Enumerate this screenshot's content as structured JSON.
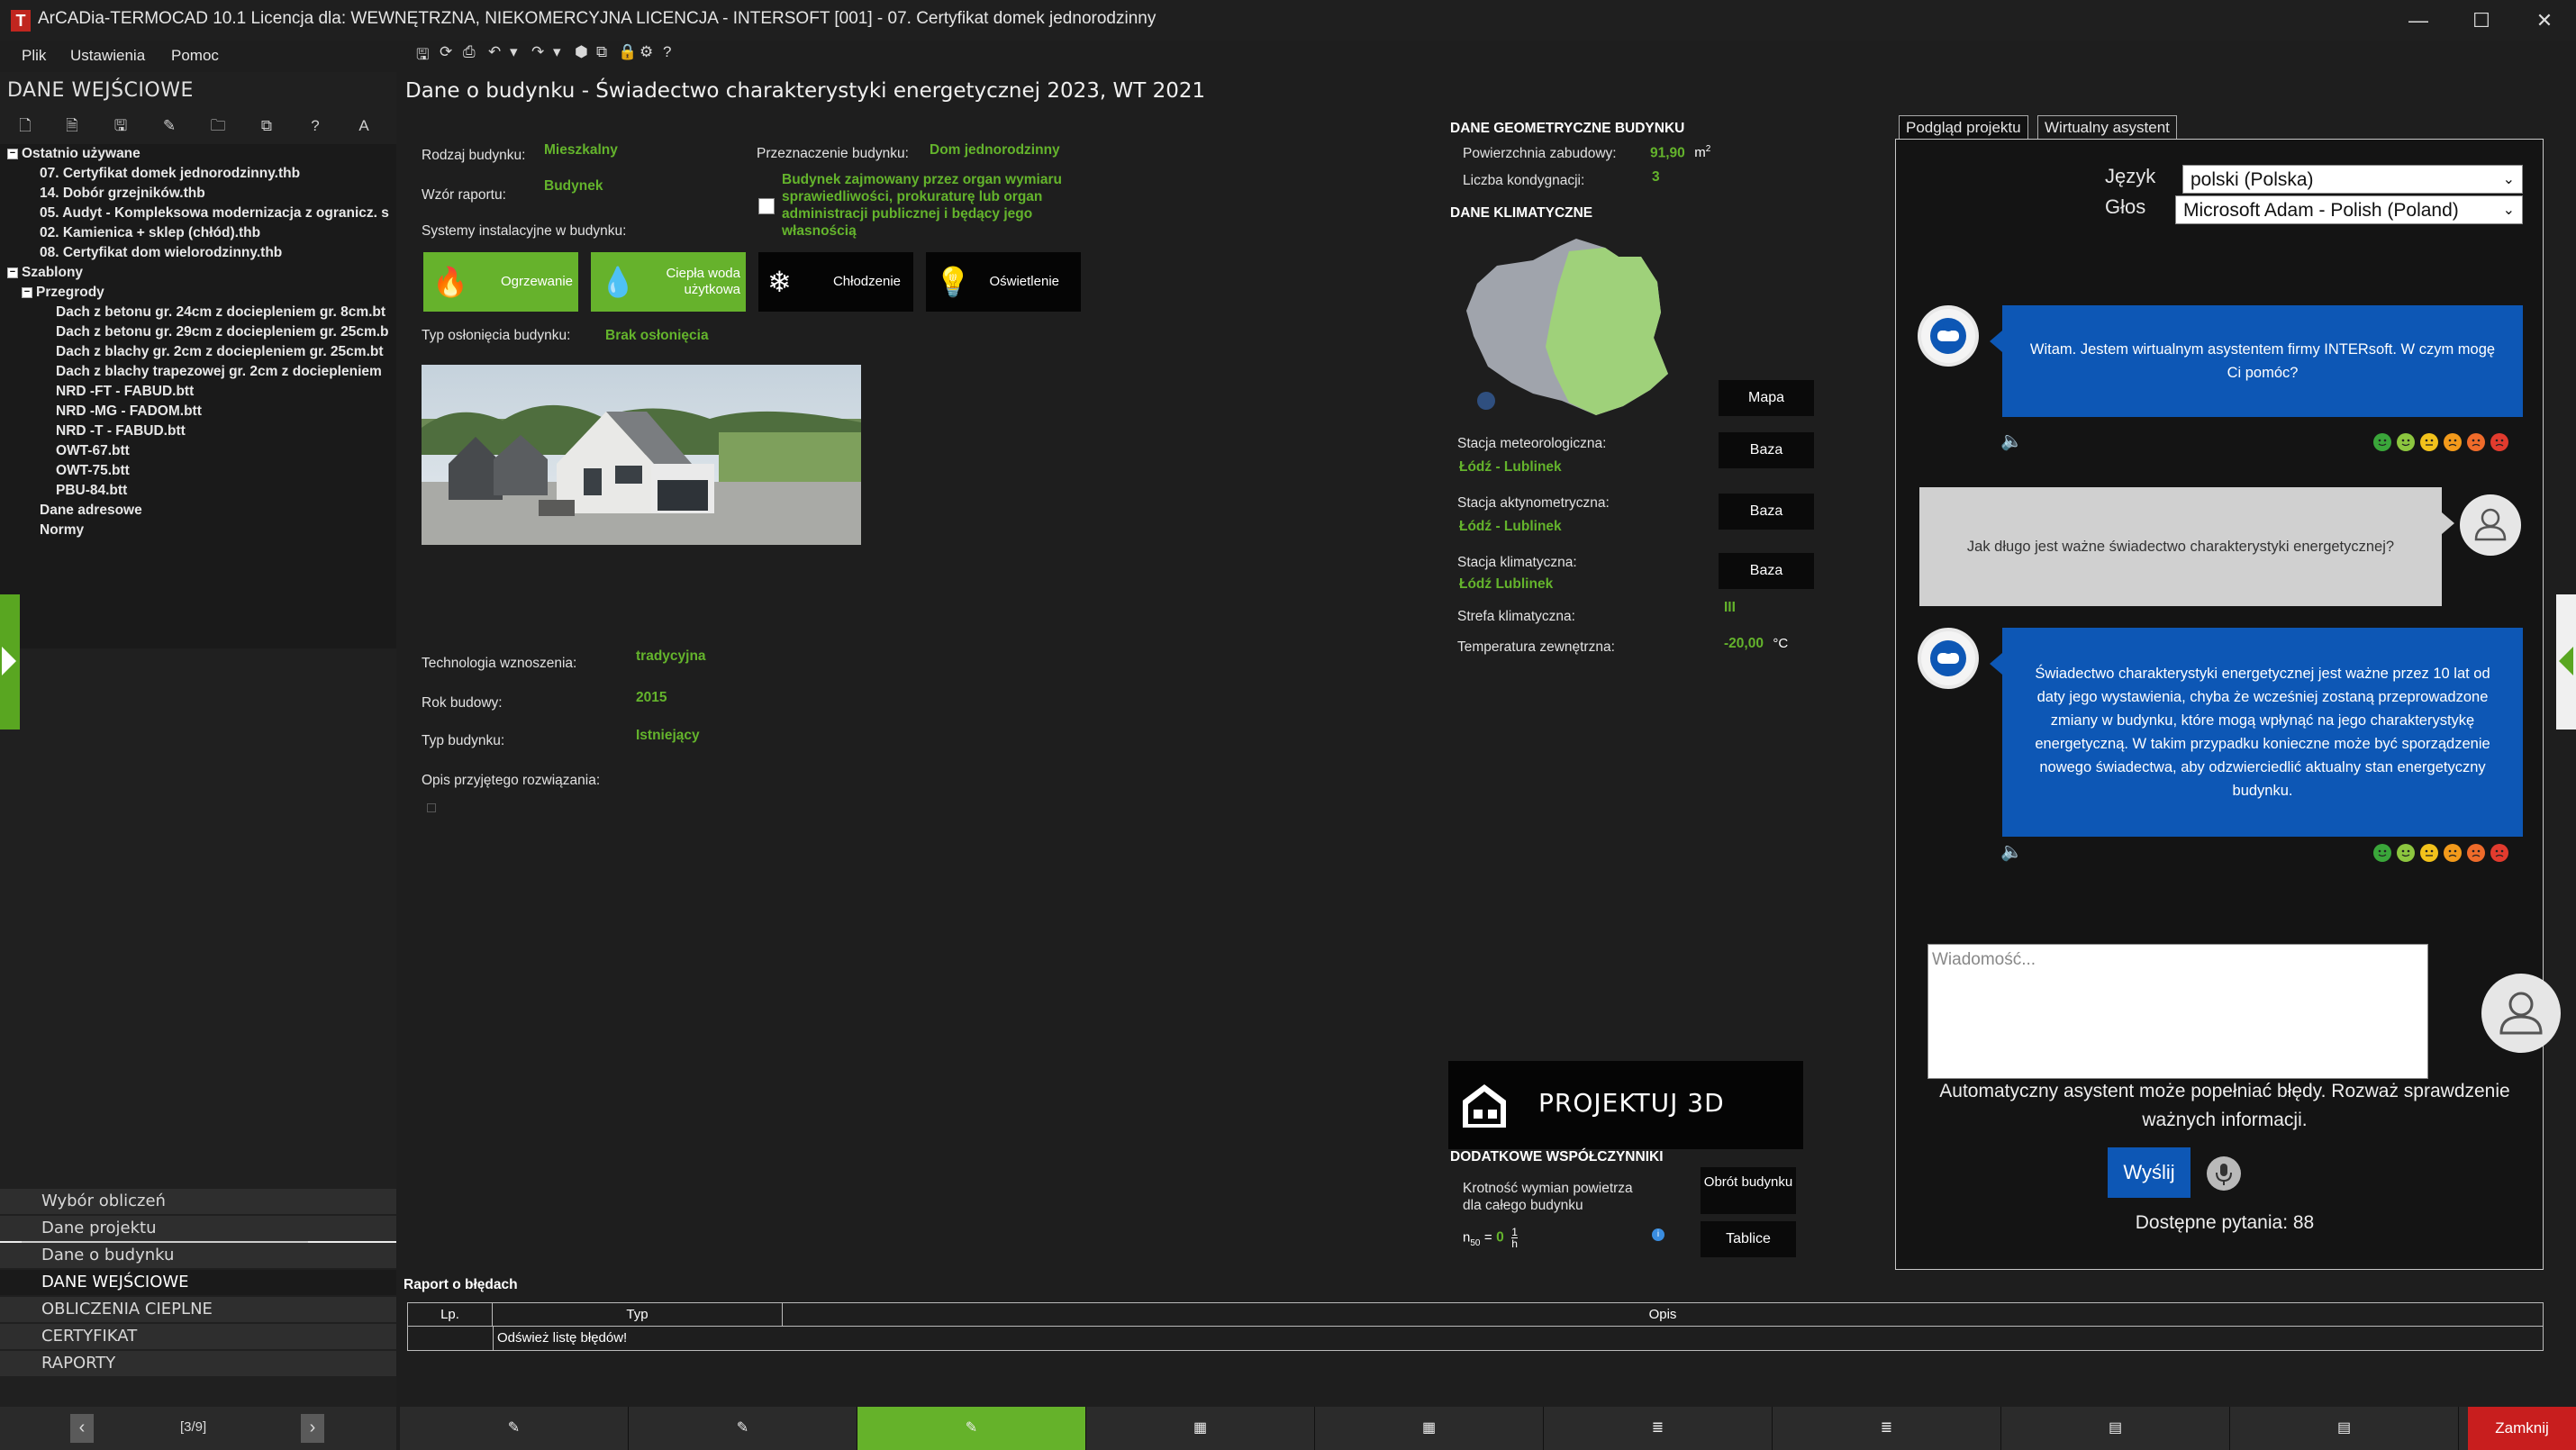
{
  "window": {
    "title": "ArCADia-TERMOCAD 10.1 Licencja dla: WEWNĘTRZNA, NIEKOMERCYJNA LICENCJA - INTERSOFT [001] - 07. Certyfikat domek jednorodzinny",
    "controls": {
      "minimize": "—",
      "maximize": "☐",
      "close": "✕"
    }
  },
  "menu": [
    "Plik",
    "Ustawienia",
    "Pomoc"
  ],
  "left": {
    "title": "DANE WEJŚCIOWE",
    "tree": {
      "recent_header": "Ostatnio używane",
      "recent": [
        "07. Certyfikat domek jednorodzinny.thb",
        "14. Dobór grzejników.thb",
        "05. Audyt - Kompleksowa modernizacja z ogranicz. s",
        "02. Kamienica + sklep (chłód).thb",
        "08. Certyfikat dom wielorodzinny.thb"
      ],
      "templates_header": "Szablony",
      "partitions_header": "Przegrody",
      "partitions": [
        "Dach z betonu gr. 24cm z dociepleniem gr. 8cm.bt",
        "Dach z betonu gr. 29cm z dociepleniem gr. 25cm.b",
        "Dach z blachy gr. 2cm z dociepleniem gr. 25cm.bt",
        "Dach z blachy trapezowej gr. 2cm z dociepleniem",
        "NRD -FT - FABUD.btt",
        "NRD -MG - FADOM.btt",
        "NRD -T - FABUD.btt",
        "OWT-67.btt",
        "OWT-75.btt",
        "PBU-84.btt"
      ],
      "address": "Dane adresowe",
      "norms": "Normy",
      "expand_sign": "−"
    },
    "scroll": {
      "left": "‹",
      "right": "›"
    },
    "nav": [
      "Wybór obliczeń",
      "Dane projektu",
      "Dane o budynku",
      "DANE WEJŚCIOWE",
      "OBLICZENIA CIEPLNE",
      "CERTYFIKAT",
      "RAPORTY"
    ],
    "pager": {
      "prev": "‹",
      "text": "[3/9]",
      "next": "›"
    }
  },
  "main": {
    "title": "Dane o budynku - Świadectwo charakterystyki energetycznej 2023, WT 2021",
    "building_type_label": "Rodzaj budynku:",
    "building_type": "Mieszkalny",
    "report_template_label": "Wzór raportu:",
    "report_template": "Budynek",
    "purpose_label": "Przeznaczenie budynku:",
    "purpose": "Dom jednorodzinny",
    "public_building": "Budynek zajmowany przez organ wymiaru sprawiedliwości, prokuraturę lub organ administracji publicznej i będący jego własnością",
    "systems_label": "Systemy instalacyjne w budynku:",
    "systems": [
      {
        "label": "Ogrzewanie",
        "icon": "flame-icon",
        "glyph": "🔥",
        "active": true
      },
      {
        "label": "Ciepła woda użytkowa",
        "icon": "water-drop-icon",
        "glyph": "💧",
        "active": true
      },
      {
        "label": "Chłodzenie",
        "icon": "snowflake-icon",
        "glyph": "❄",
        "active": false
      },
      {
        "label": "Oświetlenie",
        "icon": "lightbulb-icon",
        "glyph": "💡",
        "active": false
      }
    ],
    "shading_label": "Typ osłonięcia budynku:",
    "shading": "Brak osłonięcia",
    "technology_label": "Technologia wznoszenia:",
    "technology": "tradycyjna",
    "year_label": "Rok budowy:",
    "year": "2015",
    "btype_label": "Typ budynku:",
    "btype": "Istniejący",
    "description_label": "Opis przyjętego rozwiązania:"
  },
  "geometry": {
    "header": "DANE GEOMETRYCZNE BUDYNKU",
    "area_label": "Powierzchnia zabudowy:",
    "area": "91,90",
    "area_unit": "m",
    "area_sup": "2",
    "floors_label": "Liczba kondygnacji:",
    "floors": "3"
  },
  "climate": {
    "header": "DANE KLIMATYCZNE",
    "map_button": "Mapa",
    "meteo_label": "Stacja meteorologiczna:",
    "meteo": "Łódź - Lublinek",
    "meteo_button": "Baza",
    "actino_label": "Stacja aktynometryczna:",
    "actino": "Łódź - Lublinek",
    "actino_button": "Baza",
    "climate_label": "Stacja klimatyczna:",
    "climate": "Łódź Lublinek",
    "climate_button": "Baza",
    "zone_label": "Strefa klimatyczna:",
    "zone": "III",
    "temp_label": "Temperatura zewnętrzna:",
    "temp": "-20,00",
    "temp_unit": "°C"
  },
  "project3d": {
    "label": "PROJEKTUJ 3D"
  },
  "coefficients": {
    "header": "DODATKOWE WSPÓŁCZYNNIKI",
    "exchange_label": "Krotność wymian powietrza dla całego budynku",
    "n50_label": "n",
    "n50_sub": "50",
    "n50_eq": "=",
    "n50_value": "0",
    "unit_num": "1",
    "unit_den": "h",
    "rotate_button": "Obrót budynku",
    "tables_button": "Tablice"
  },
  "assistant": {
    "tabs": [
      "Podgląd projektu",
      "Wirtualny asystent"
    ],
    "language_label": "Język",
    "language": "polski (Polska)",
    "voice_label": "Głos",
    "voice": "Microsoft Adam - Polish (Poland)",
    "messages": [
      {
        "from": "bot",
        "text": "Witam. Jestem wirtualnym asystentem firmy INTERsoft. W czym mogę Ci pomóc?"
      },
      {
        "from": "user",
        "text": "Jak długo jest ważne świadectwo charakterystyki energetycznej?"
      },
      {
        "from": "bot",
        "text": "Świadectwo charakterystyki energetycznej jest ważne przez 10 lat od daty jego wystawienia, chyba że wcześniej zostaną przeprowadzone zmiany w budynku, które mogą wpłynąć na jego charakterystykę energetyczną. W takim przypadku konieczne może być sporządzenie nowego świadectwa, aby odzwierciedlić aktualny stan energetyczny budynku."
      }
    ],
    "emoji_colors": [
      "#3aa63a",
      "#8cc63f",
      "#f2c21b",
      "#f29a1b",
      "#ef6b2a",
      "#e23b2e"
    ],
    "input_placeholder": "Wiadomość...",
    "disclaimer": "Automatyczny asystent może popełniać błędy. Rozważ sprawdzenie ważnych informacji.",
    "send": "Wyślij",
    "remaining": "Dostępne pytania: 88"
  },
  "errors": {
    "title": "Raport o błędach",
    "columns": [
      "Lp.",
      "Typ",
      "Opis"
    ],
    "refresh": "Odśwież listę błędów!"
  },
  "bottom": {
    "close": "Zamknij",
    "active_color": "#65b22a"
  }
}
